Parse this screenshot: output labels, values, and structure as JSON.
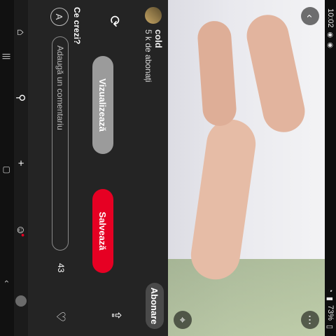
{
  "status": {
    "time": "10:02",
    "battery": "73%"
  },
  "post": {
    "author_name": "cold",
    "followers": "5 k de abonați",
    "follow_label": "Abonare",
    "view_label": "Vizualizează",
    "save_label": "Salvează"
  },
  "comments": {
    "prompt": "Ce crezi?",
    "user_initial": "A",
    "placeholder": "Adaugă un comentariu",
    "like_count": "43"
  },
  "colors": {
    "save_red": "#e60023",
    "panel_bg": "#242424"
  },
  "icons": {
    "back": "back-icon",
    "more": "more-icon",
    "lens": "lens-icon",
    "share": "share-icon",
    "heart": "heart-icon",
    "pin": "pin-icon",
    "home": "home-icon",
    "search": "search-icon",
    "add": "add-icon",
    "messages": "chat-icon"
  }
}
